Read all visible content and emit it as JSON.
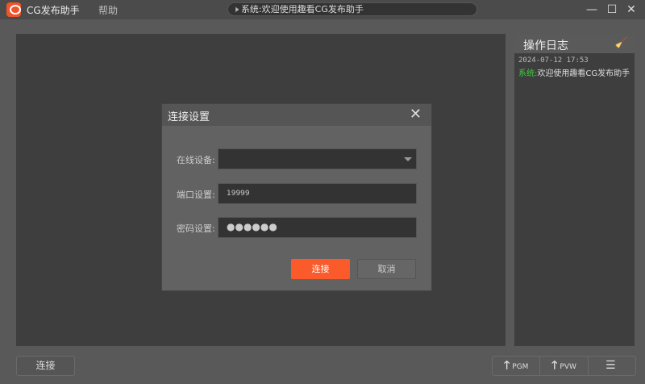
{
  "app": {
    "title": "CG发布助手",
    "menu_help": "帮助"
  },
  "notice": {
    "text": "系统:欢迎使用趣看CG发布助手"
  },
  "log": {
    "title": "操作日志",
    "entries": [
      {
        "time": "2024-07-12 17:53",
        "source": "系统:",
        "message": "欢迎使用趣看CG发布助手"
      }
    ]
  },
  "bottom": {
    "connect": "连接",
    "pgm": "PGM",
    "pvw": "PVW"
  },
  "dialog": {
    "title": "连接设置",
    "device_label": "在线设备:",
    "device_value": "",
    "port_label": "端口设置:",
    "port_value": "19999",
    "password_label": "密码设置:",
    "password_value": "●●●●●●",
    "ok": "连接",
    "cancel": "取消"
  },
  "colors": {
    "accent": "#fb5a2b",
    "log_source": "#3ad23a"
  }
}
